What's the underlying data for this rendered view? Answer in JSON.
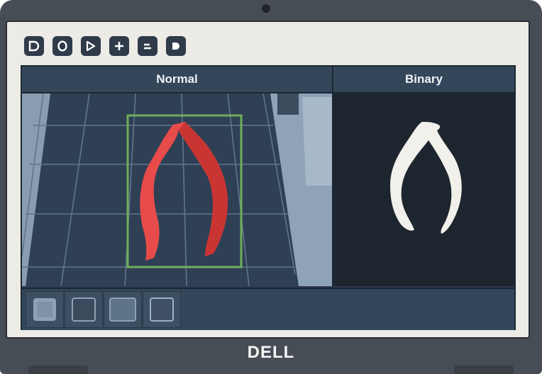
{
  "colors": {
    "bezel": "#474d55",
    "panel": "#2c3a4b",
    "header": "#34465a",
    "detection_box": "#6fae5a",
    "object_red": "#e84c4a",
    "mask_white": "#f2f0ea",
    "binary_bg": "#1d252e"
  },
  "toolbar": {
    "buttons": [
      {
        "icon": "d-shape-icon"
      },
      {
        "icon": "circle-icon"
      },
      {
        "icon": "play-icon"
      },
      {
        "icon": "plus-icon"
      },
      {
        "icon": "minus-icon"
      },
      {
        "icon": "d-shape-icon"
      }
    ]
  },
  "panels": {
    "normal_label": "Normal",
    "binary_label": "Binary"
  },
  "thumbnails": [
    {
      "selected": true
    },
    {
      "selected": false
    },
    {
      "selected": false
    },
    {
      "selected": false
    }
  ],
  "brand": "DELL"
}
